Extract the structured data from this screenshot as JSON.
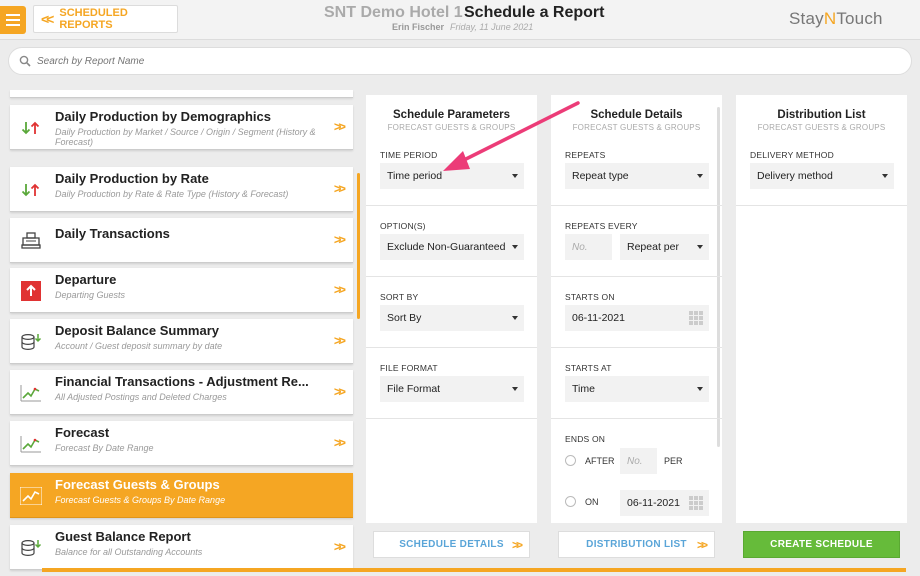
{
  "header": {
    "back_label": "SCHEDULED REPORTS",
    "hotel_name": "SNT Demo Hotel 1",
    "page_title": "Schedule a Report",
    "user_name": "Erin Fischer",
    "business_date": "Friday, 11 June 2021",
    "brand_pre": "Stay",
    "brand_n": "N",
    "brand_post": "Touch"
  },
  "search": {
    "placeholder": "Search by Report Name"
  },
  "reports": [
    {
      "title": "Daily Production by Demographics",
      "subtitle": "Daily Production by Market / Source / Origin / Segment (History & Forecast)",
      "icon": "up-down-arrows-icon"
    },
    {
      "title": "Daily Production by Rate",
      "subtitle": "Daily Production by Rate & Rate Type (History & Forecast)",
      "icon": "up-down-arrows-icon"
    },
    {
      "title": "Daily Transactions",
      "subtitle": "",
      "icon": "register-icon"
    },
    {
      "title": "Departure",
      "subtitle": "Departing Guests",
      "icon": "departure-icon"
    },
    {
      "title": "Deposit Balance Summary",
      "subtitle": "Account / Guest deposit summary by date",
      "icon": "coins-icon"
    },
    {
      "title": "Financial Transactions - Adjustment Re...",
      "subtitle": "All Adjusted Postings and Deleted Charges",
      "icon": "trend-chart-icon"
    },
    {
      "title": "Forecast",
      "subtitle": "Forecast By Date Range",
      "icon": "trend-chart-icon"
    },
    {
      "title": "Forecast Guests & Groups",
      "subtitle": "Forecast Guests & Groups By Date Range",
      "icon": "trend-chart-icon"
    },
    {
      "title": "Guest Balance Report",
      "subtitle": "Balance for all Outstanding Accounts",
      "icon": "coins-icon"
    }
  ],
  "params": {
    "title": "Schedule Parameters",
    "subtitle": "FORECAST GUESTS & GROUPS",
    "time_period_label": "TIME PERIOD",
    "time_period_value": "Time period",
    "options_label": "OPTION(S)",
    "options_value": "Exclude Non-Guaranteed",
    "sort_label": "SORT BY",
    "sort_value": "Sort By",
    "format_label": "FILE FORMAT",
    "format_value": "File Format",
    "footer_btn": "SCHEDULE DETAILS"
  },
  "details": {
    "title": "Schedule Details",
    "subtitle": "FORECAST GUESTS & GROUPS",
    "repeats_label": "REPEATS",
    "repeats_value": "Repeat type",
    "repeats_every_label": "REPEATS EVERY",
    "repeats_every_placeholder": "No.",
    "repeat_per_value": "Repeat per",
    "starts_on_label": "STARTS ON",
    "starts_on_value": "06-11-2021",
    "starts_at_label": "STARTS AT",
    "starts_at_value": "Time",
    "ends_on_label": "ENDS ON",
    "after_label": "AFTER",
    "after_placeholder": "No.",
    "per_label": "PER",
    "on_label": "ON",
    "ends_on_date": "06-11-2021",
    "footer_btn": "DISTRIBUTION LIST"
  },
  "distribution": {
    "title": "Distribution List",
    "subtitle": "FORECAST GUESTS & GROUPS",
    "method_label": "DELIVERY METHOD",
    "method_value": "Delivery method",
    "create_btn": "CREATE SCHEDULE"
  },
  "colors": {
    "accent": "#f5a623",
    "link": "#5aa5d8",
    "success": "#66bb3a",
    "annotation": "#ec3c78"
  }
}
